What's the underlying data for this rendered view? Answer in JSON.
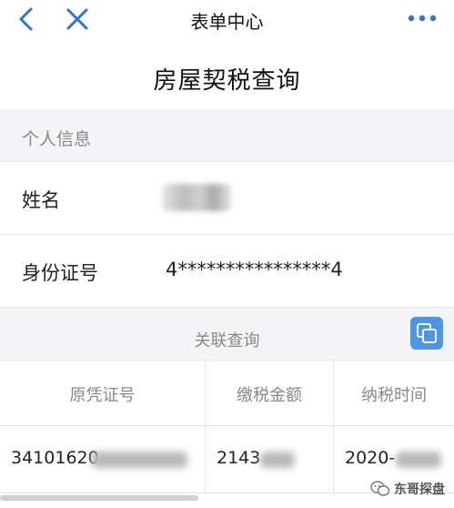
{
  "nav": {
    "title": "表单中心",
    "back_icon": "chevron-left-icon",
    "close_icon": "close-icon",
    "more_icon": "more-horizontal-icon",
    "accent_color": "#2b74d8"
  },
  "page_title": "房屋契税查询",
  "personal": {
    "section_label": "个人信息",
    "name_label": "姓名",
    "id_label": "身份证号",
    "id_value": "4****************4"
  },
  "related": {
    "label": "关联查询",
    "copy_icon": "copy-icon",
    "button_color": "#4a97ea"
  },
  "table": {
    "columns": [
      "原凭证号",
      "缴税金额",
      "纳税时间"
    ],
    "rows": [
      [
        "34101620",
        "2143",
        "2020-"
      ]
    ]
  },
  "watermark": {
    "text": "东哥探盘",
    "icon": "wechat-logo-icon"
  }
}
